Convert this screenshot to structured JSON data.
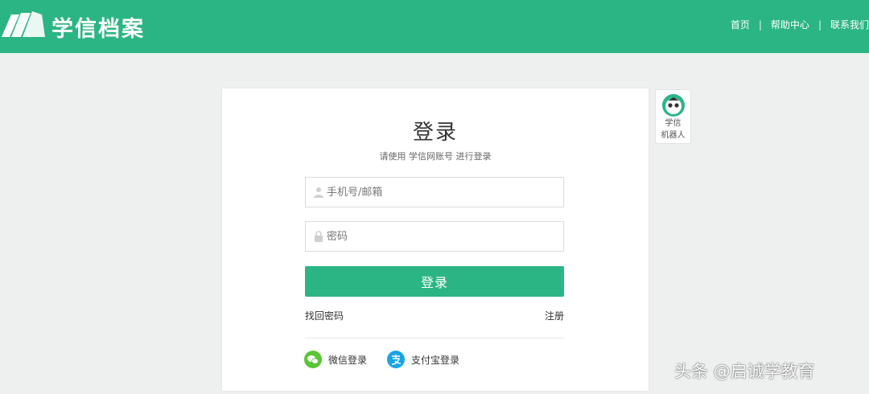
{
  "header": {
    "logo_text": "学信档案",
    "nav": {
      "home": "首页",
      "help": "帮助中心",
      "contact": "联系我们",
      "separator": "|"
    },
    "bg_color": "#2bb584"
  },
  "login": {
    "title": "登录",
    "subtitle": "请使用 学信网账号 进行登录",
    "phone_placeholder": "手机号/邮箱",
    "password_placeholder": "密码",
    "submit_label": "登录",
    "forgot_label": "找回密码",
    "register_label": "注册",
    "wechat_label": "微信登录",
    "alipay_label": "支付宝登录"
  },
  "robot": {
    "label_line1": "学信",
    "label_line2": "机器人"
  },
  "watermark": "头条 @启诚学教育",
  "icons": [
    "logo-book-icon",
    "user-icon",
    "lock-icon",
    "wechat-icon",
    "alipay-icon",
    "robot-avatar-icon"
  ],
  "colors": {
    "accent": "#2bb584",
    "wechat": "#5ac535",
    "alipay": "#1aa3e6"
  }
}
